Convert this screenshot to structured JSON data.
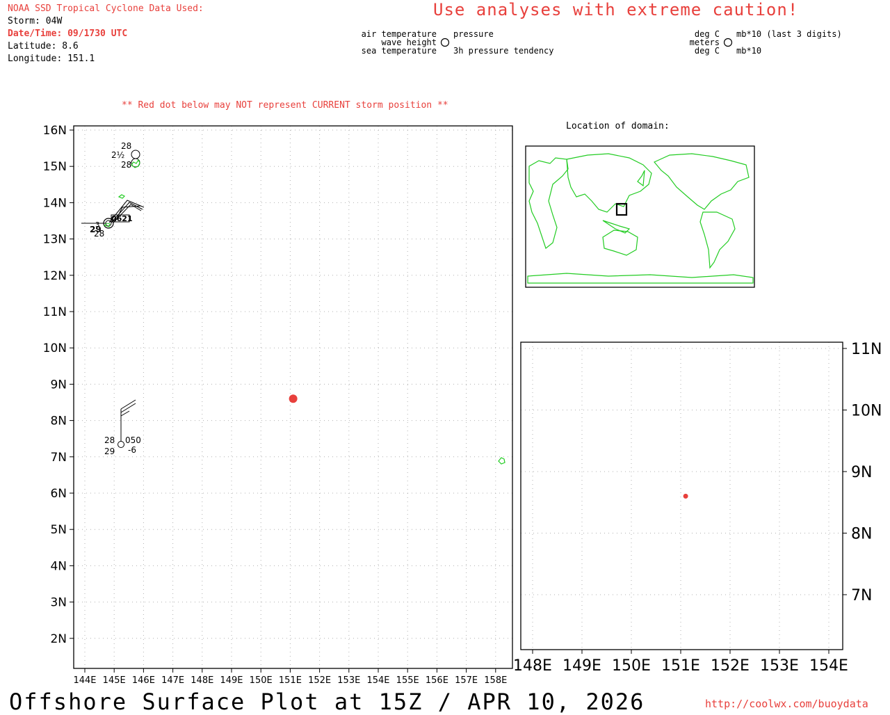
{
  "header": {
    "source_line": "NOAA SSD Tropical Cyclone Data Used:",
    "storm": "Storm: 04W",
    "datetime": "Date/Time: 09/1730 UTC",
    "latitude": "Latitude: 8.6",
    "longitude": "Longitude: 151.1",
    "warning": "Use analyses with extreme caution!"
  },
  "legend_left": {
    "air_temperature": "air temperature",
    "wave_height": "wave height",
    "sea_temperature": "sea temperature",
    "pressure": "pressure",
    "pressure_tendency": "3h pressure tendency"
  },
  "legend_right": {
    "deg_c_top": "deg C",
    "meters": "meters",
    "deg_c_bottom": "deg C",
    "mb_last3": "mb*10 (last 3 digits)",
    "mb10": "mb*10"
  },
  "notice": "** Red dot below may NOT represent CURRENT storm position **",
  "inset_title": "Location of domain:",
  "footer": {
    "title": "Offshore Surface Plot at 15Z / APR 10, 2026",
    "url": "http://coolwx.com/buoydata"
  },
  "colors": {
    "accent_red": "#e8403c",
    "coast_green": "#22cc22",
    "grid": "#b0b0b0"
  },
  "storm_position": {
    "lat": 8.6,
    "lon": 151.1
  },
  "main_map": {
    "lat_labels": [
      "16N",
      "15N",
      "14N",
      "13N",
      "12N",
      "11N",
      "10N",
      "9N",
      "8N",
      "7N",
      "6N",
      "5N",
      "4N",
      "3N",
      "2N"
    ],
    "lon_labels": [
      "144E",
      "145E",
      "146E",
      "147E",
      "148E",
      "149E",
      "150E",
      "151E",
      "152E",
      "153E",
      "154E",
      "155E",
      "156E",
      "157E",
      "158E"
    ]
  },
  "zoom_map": {
    "lat_labels": [
      "11N",
      "10N",
      "9N",
      "8N",
      "7N"
    ],
    "lon_labels": [
      "148E",
      "149E",
      "150E",
      "151E",
      "152E",
      "153E",
      "154E"
    ]
  },
  "stations": {
    "upper": {
      "air_temp": "28",
      "wave": "2½",
      "sea_temp": "28"
    },
    "cluster": {
      "a": "29",
      "b": "28",
      "c": "3",
      "d": "0621"
    },
    "lower": {
      "air_temp": "28",
      "pressure": "050",
      "sea_temp": "29",
      "tendency": "-6"
    }
  }
}
